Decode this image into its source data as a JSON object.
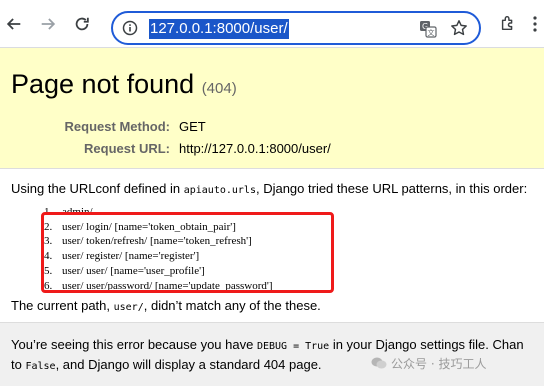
{
  "browser": {
    "url": "127.0.0.1:8000/user/"
  },
  "page": {
    "title": "Page not found",
    "status_code": "(404)",
    "request_method_label": "Request Method:",
    "request_method": "GET",
    "request_url_label": "Request URL:",
    "request_url": "http://127.0.0.1:8000/user/"
  },
  "info": {
    "urlconf_prefix": "Using the URLconf defined in ",
    "urlconf_module": "apiauto.urls",
    "urlconf_suffix": ", Django tried these URL patterns, in this order:",
    "patterns": [
      {
        "num": "1.",
        "text": "admin/"
      },
      {
        "num": "2.",
        "text": "user/ login/ [name='token_obtain_pair']"
      },
      {
        "num": "3.",
        "text": "user/ token/refresh/ [name='token_refresh']"
      },
      {
        "num": "4.",
        "text": "user/ register/ [name='register']"
      },
      {
        "num": "5.",
        "text": "user/ user/ [name='user_profile']"
      },
      {
        "num": "6.",
        "text": "user/ user/password/ [name='update_password']"
      }
    ],
    "current_path_prefix": "The current path, ",
    "current_path": "user/",
    "current_path_suffix": ", didn’t match any of the these."
  },
  "explanation": {
    "line1_prefix": "You’re seeing this error because you have ",
    "debug_setting": "DEBUG = True",
    "line1_suffix": " in your Django settings file. Chan",
    "line2_prefix": "to ",
    "false_value": "False",
    "line2_suffix": ", and Django will display a standard 404 page."
  },
  "watermark": {
    "text": "公众号 · 技巧工人"
  }
}
